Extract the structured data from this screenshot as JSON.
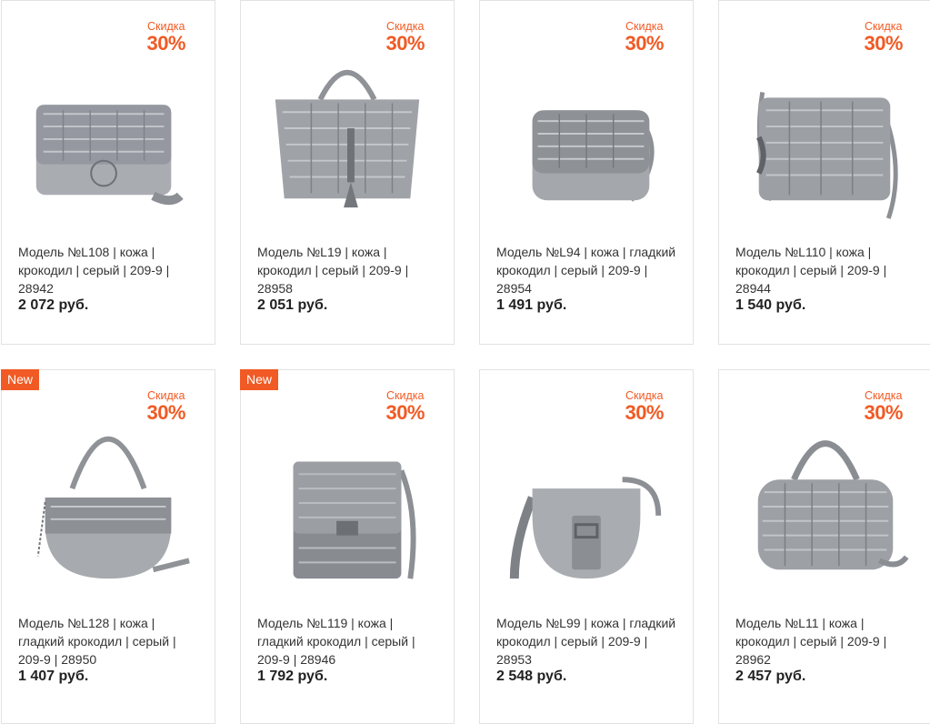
{
  "colors": {
    "accent": "#f15a24",
    "bag": "#9ea1a5",
    "bag_dark": "#7d8084"
  },
  "discount_label": "Скидка",
  "discount_value": "30%",
  "new_label": "New",
  "products": [
    {
      "title": "Модель №L108 | кожа | крокодил | серый | 209-9 | 28942",
      "price": "2 072 руб.",
      "is_new": false,
      "icon": "flap-crossbody-bag-icon"
    },
    {
      "title": "Модель №L19 | кожа | крокодил | серый | 209-9 | 28958",
      "price": "2 051 руб.",
      "is_new": false,
      "icon": "tote-bag-icon"
    },
    {
      "title": "Модель №L94 | кожа | гладкий крокодил | серый | 209-9 | 28954",
      "price": "1 491 руб.",
      "is_new": false,
      "icon": "flap-crossbody-bag-icon"
    },
    {
      "title": "Модель №L110 | кожа | крокодил | серый | 209-9 | 28944",
      "price": "1 540 руб.",
      "is_new": false,
      "icon": "zip-crossbody-bag-icon"
    },
    {
      "title": "Модель №L128 | кожа | гладкий крокодил | серый | 209-9 | 28950",
      "price": "1 407 руб.",
      "is_new": true,
      "icon": "saddle-shoulder-bag-icon"
    },
    {
      "title": "Модель №L119 | кожа | гладкий крокодил | серый | 209-9 | 28946",
      "price": "1 792 руб.",
      "is_new": true,
      "icon": "square-crossbody-bag-icon"
    },
    {
      "title": "Модель №L99 | кожа | гладкий крокодил | серый | 209-9 | 28953",
      "price": "2 548 руб.",
      "is_new": false,
      "icon": "saddle-buckle-bag-icon"
    },
    {
      "title": "Модель №L11 | кожа | крокодил | серый | 209-9 | 28962",
      "price": "2 457 руб.",
      "is_new": false,
      "icon": "barrel-bag-icon"
    }
  ]
}
